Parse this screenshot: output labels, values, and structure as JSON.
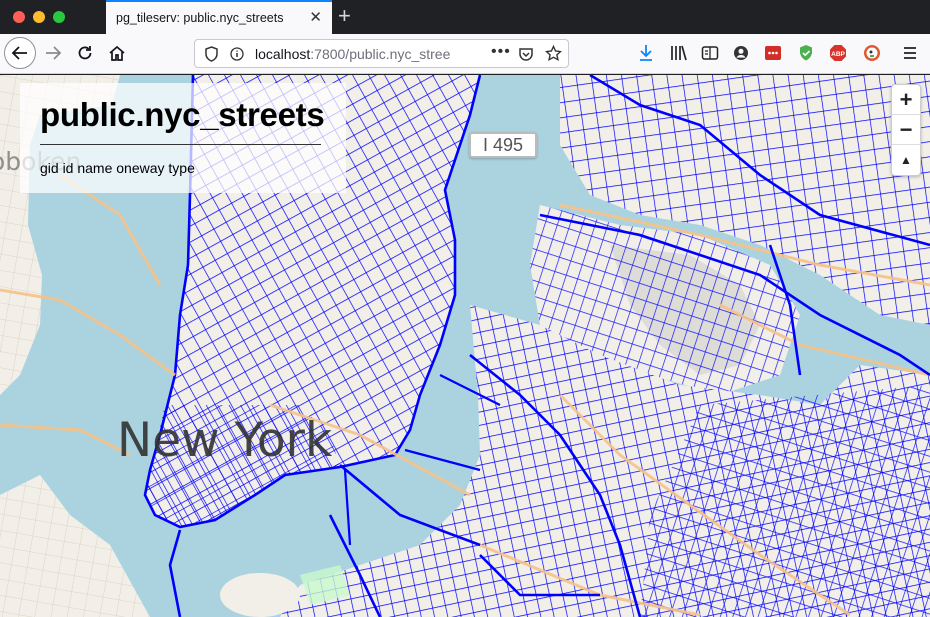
{
  "browser": {
    "tab_title": "pg_tileserv: public.nyc_streets",
    "tab_close_icon": "close-icon",
    "new_tab_icon": "plus-icon",
    "url_host": "localhost",
    "url_rest": ":7800/public.nyc_stree",
    "toolbar_icons": [
      "download-icon",
      "library-icon",
      "reader-view-icon",
      "account-icon",
      "lastpass-icon",
      "shield-check-icon",
      "abp-icon",
      "duckduckgo-icon",
      "menu-icon"
    ],
    "accent_color": "#0a84ff"
  },
  "map": {
    "panel": {
      "title": "public.nyc_streets",
      "fields": "gid id name oneway type"
    },
    "labels": {
      "city": "New York",
      "hoboken": "oboken",
      "highway_shield": "I 495"
    },
    "zoom": {
      "in_label": "+",
      "out_label": "−",
      "reset_label": "▲"
    },
    "colors": {
      "water": "#aad3df",
      "land": "#f2efe9",
      "streets": "#0000ff",
      "arterials": "#f6c288"
    }
  }
}
